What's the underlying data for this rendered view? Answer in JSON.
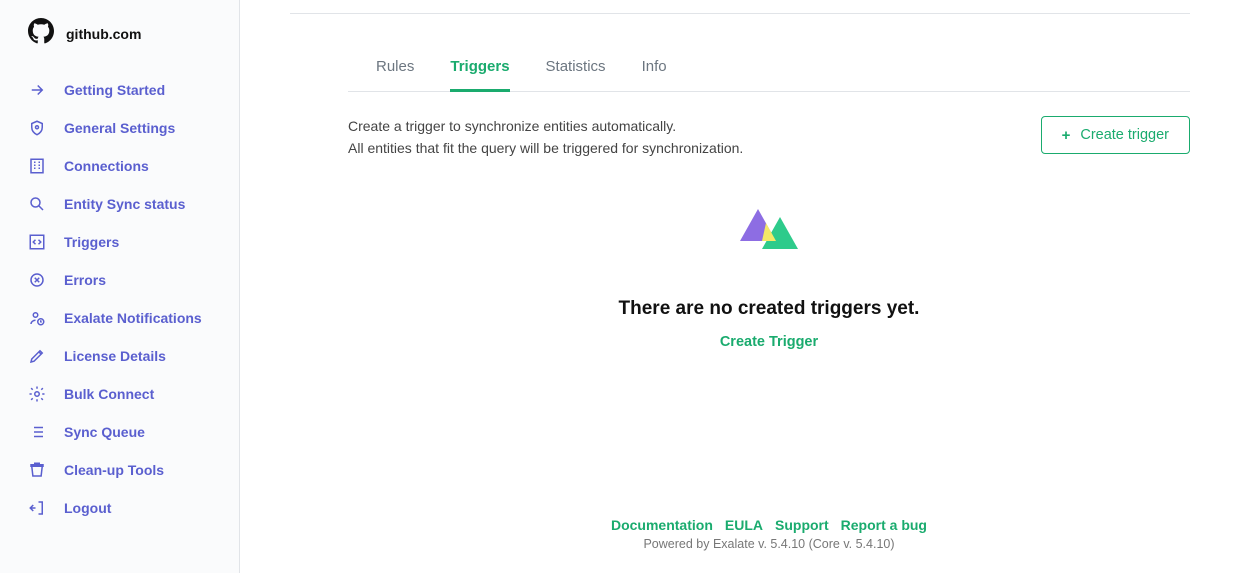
{
  "brand": {
    "name": "github.com"
  },
  "sidebar": {
    "items": [
      {
        "label": "Getting Started"
      },
      {
        "label": "General Settings"
      },
      {
        "label": "Connections"
      },
      {
        "label": "Entity Sync status"
      },
      {
        "label": "Triggers"
      },
      {
        "label": "Errors"
      },
      {
        "label": "Exalate Notifications"
      },
      {
        "label": "License Details"
      },
      {
        "label": "Bulk Connect"
      },
      {
        "label": "Sync Queue"
      },
      {
        "label": "Clean-up Tools"
      },
      {
        "label": "Logout"
      }
    ]
  },
  "tabs": [
    {
      "label": "Rules",
      "active": false
    },
    {
      "label": "Triggers",
      "active": true
    },
    {
      "label": "Statistics",
      "active": false
    },
    {
      "label": "Info",
      "active": false
    }
  ],
  "subhead": {
    "line1": "Create a trigger to synchronize entities automatically.",
    "line2": "All entities that fit the query will be triggered for synchronization."
  },
  "buttons": {
    "create_trigger": "Create trigger"
  },
  "empty": {
    "title": "There are no created triggers yet.",
    "link": "Create Trigger"
  },
  "footer": {
    "links": {
      "documentation": "Documentation",
      "eula": "EULA",
      "support": "Support",
      "report": "Report a bug"
    },
    "powered": "Powered by Exalate v. 5.4.10 (Core v. 5.4.10)"
  },
  "colors": {
    "accent": "#1aab6e",
    "sidebar_link": "#5a5fcf"
  }
}
